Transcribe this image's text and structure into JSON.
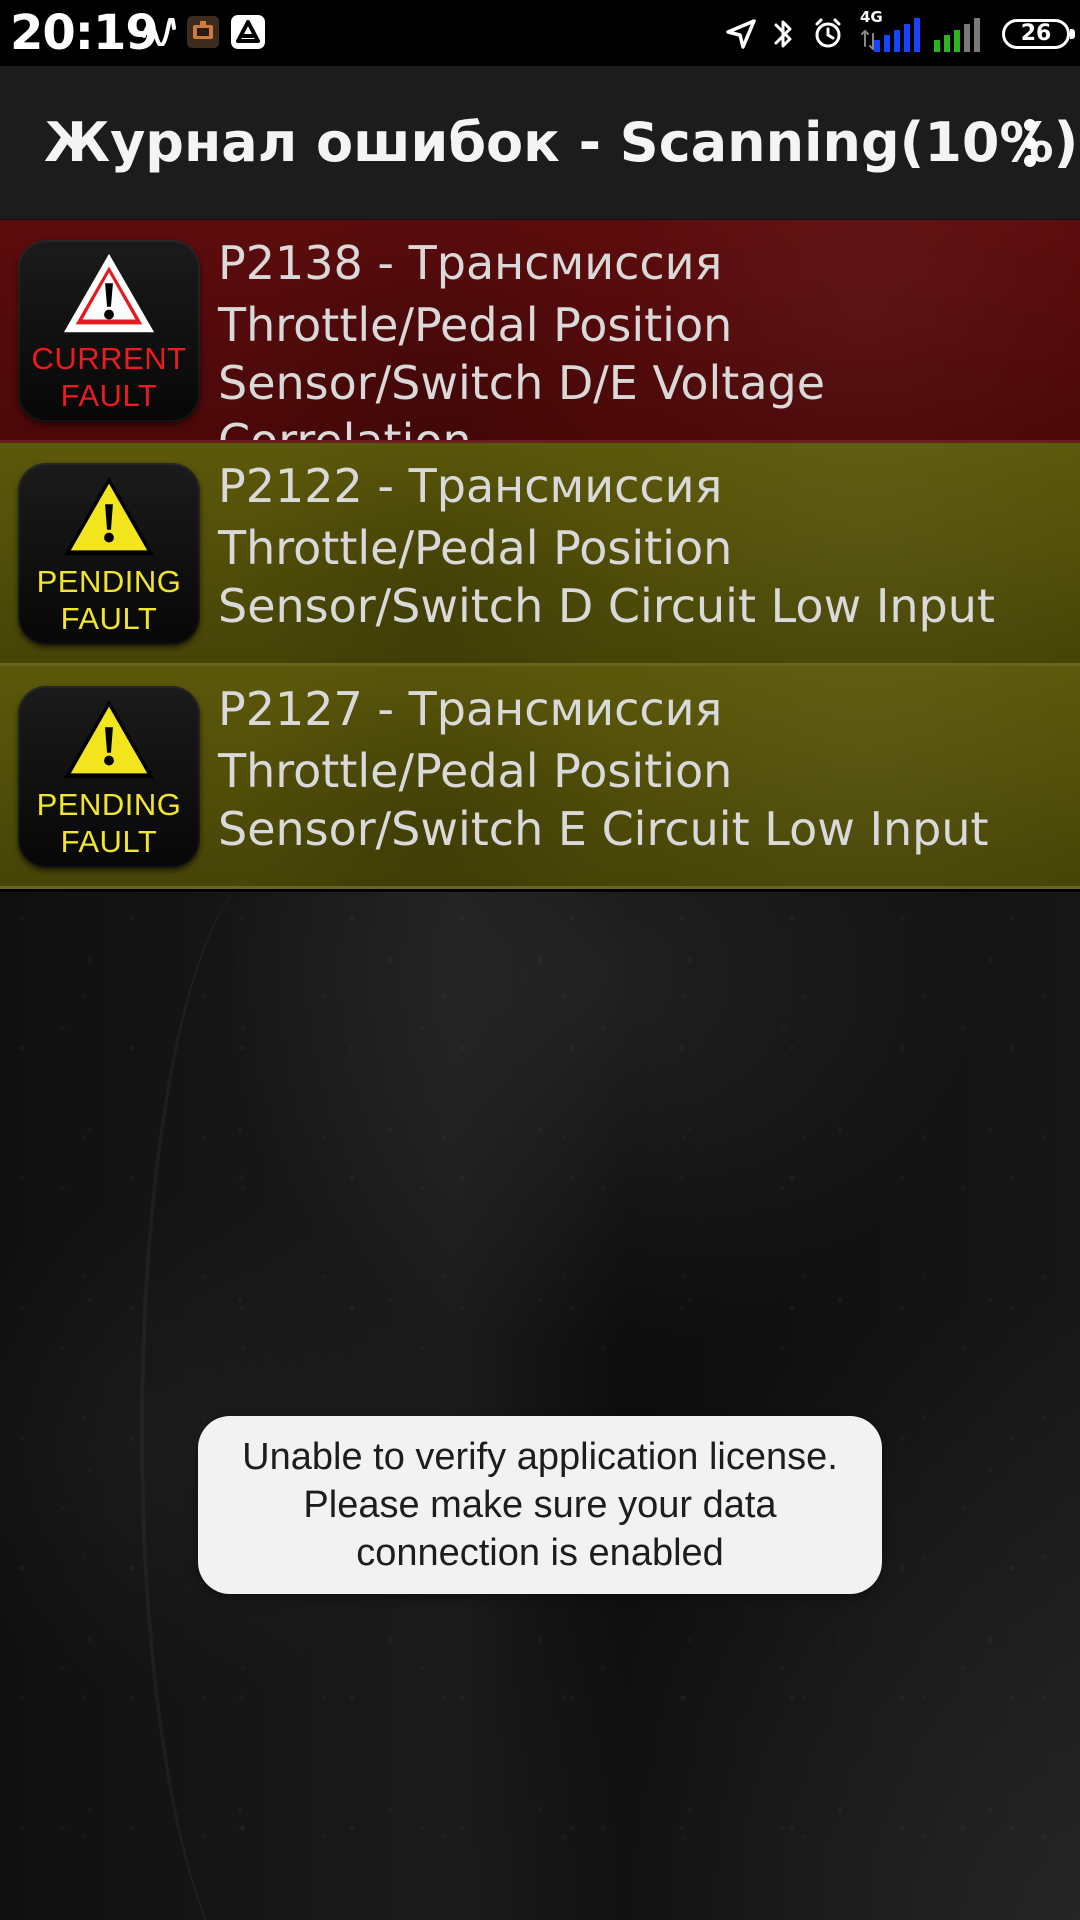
{
  "status_bar": {
    "time": "20:19",
    "network_type": "4G",
    "battery_level": "26",
    "icons": [
      "signal-wave-icon",
      "obd-app-icon",
      "navigation-app-icon",
      "location-arrow-icon",
      "bluetooth-icon",
      "alarm-icon",
      "data-arrows-icon",
      "cellular-signal-blue-icon",
      "cellular-signal-green-icon",
      "battery-icon"
    ]
  },
  "app_bar": {
    "title": "Журнал ошибок - Scanning(10%)",
    "menu_icon": "more-vertical-icon"
  },
  "faults": [
    {
      "code": "P2138 - Трансмиссия",
      "description": "Throttle/Pedal Position Sensor/Switch D/E Voltage Correlation",
      "badge_line1": "CURRENT",
      "badge_line2": "FAULT",
      "badge_color": "#ea1c1f",
      "row_color": "#5d0c0d",
      "icon": "warning-triangle-icon"
    },
    {
      "code": "P2122 - Трансмиссия",
      "description": "Throttle/Pedal Position Sensor/Switch D Circuit Low Input",
      "badge_line1": "PENDING",
      "badge_line2": "FAULT",
      "badge_color": "#f1e52e",
      "row_color": "#5c580b",
      "icon": "warning-triangle-icon"
    },
    {
      "code": "P2127 - Трансмиссия",
      "description": "Throttle/Pedal Position Sensor/Switch E Circuit Low Input",
      "badge_line1": "PENDING",
      "badge_line2": "FAULT",
      "badge_color": "#f1e52e",
      "row_color": "#5c580b",
      "icon": "warning-triangle-icon"
    }
  ],
  "toast": {
    "message": "Unable to verify application license. Please make sure your data connection is enabled"
  }
}
